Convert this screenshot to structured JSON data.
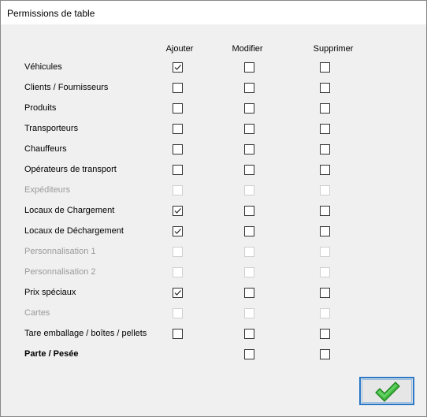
{
  "window": {
    "title": "Permissions de table"
  },
  "columns": [
    "Ajouter",
    "Modifier",
    "Supprimer"
  ],
  "rows": [
    {
      "label": "Véhicules",
      "enabled": true,
      "bold": false,
      "ajouter": true,
      "modifier": false,
      "supprimer": false
    },
    {
      "label": "Clients / Fournisseurs",
      "enabled": true,
      "bold": false,
      "ajouter": false,
      "modifier": false,
      "supprimer": false
    },
    {
      "label": "Produits",
      "enabled": true,
      "bold": false,
      "ajouter": false,
      "modifier": false,
      "supprimer": false
    },
    {
      "label": "Transporteurs",
      "enabled": true,
      "bold": false,
      "ajouter": false,
      "modifier": false,
      "supprimer": false
    },
    {
      "label": "Chauffeurs",
      "enabled": true,
      "bold": false,
      "ajouter": false,
      "modifier": false,
      "supprimer": false
    },
    {
      "label": "Opérateurs de transport",
      "enabled": true,
      "bold": false,
      "ajouter": false,
      "modifier": false,
      "supprimer": false
    },
    {
      "label": "Expéditeurs",
      "enabled": false,
      "bold": false,
      "ajouter": false,
      "modifier": false,
      "supprimer": false
    },
    {
      "label": "Locaux de Chargement",
      "enabled": true,
      "bold": false,
      "ajouter": true,
      "modifier": false,
      "supprimer": false
    },
    {
      "label": "Locaux de Déchargement",
      "enabled": true,
      "bold": false,
      "ajouter": true,
      "modifier": false,
      "supprimer": false
    },
    {
      "label": "Personnalisation 1",
      "enabled": false,
      "bold": false,
      "ajouter": false,
      "modifier": false,
      "supprimer": false
    },
    {
      "label": "Personnalisation 2",
      "enabled": false,
      "bold": false,
      "ajouter": false,
      "modifier": false,
      "supprimer": false
    },
    {
      "label": "Prix spéciaux",
      "enabled": true,
      "bold": false,
      "ajouter": true,
      "modifier": false,
      "supprimer": false
    },
    {
      "label": "Cartes",
      "enabled": false,
      "bold": false,
      "ajouter": false,
      "modifier": false,
      "supprimer": false
    },
    {
      "label": "Tare emballage / boîtes / pellets",
      "enabled": true,
      "bold": false,
      "ajouter": false,
      "modifier": false,
      "supprimer": false
    },
    {
      "label": "Parte / Pesée",
      "enabled": true,
      "bold": true,
      "ajouter": null,
      "modifier": false,
      "supprimer": false
    }
  ],
  "ok_button": {
    "icon": "green-checkmark-icon",
    "color": "#3cb83c"
  },
  "colors": {
    "accent": "#2b78c8",
    "disabled_text": "#9a9a9a"
  }
}
